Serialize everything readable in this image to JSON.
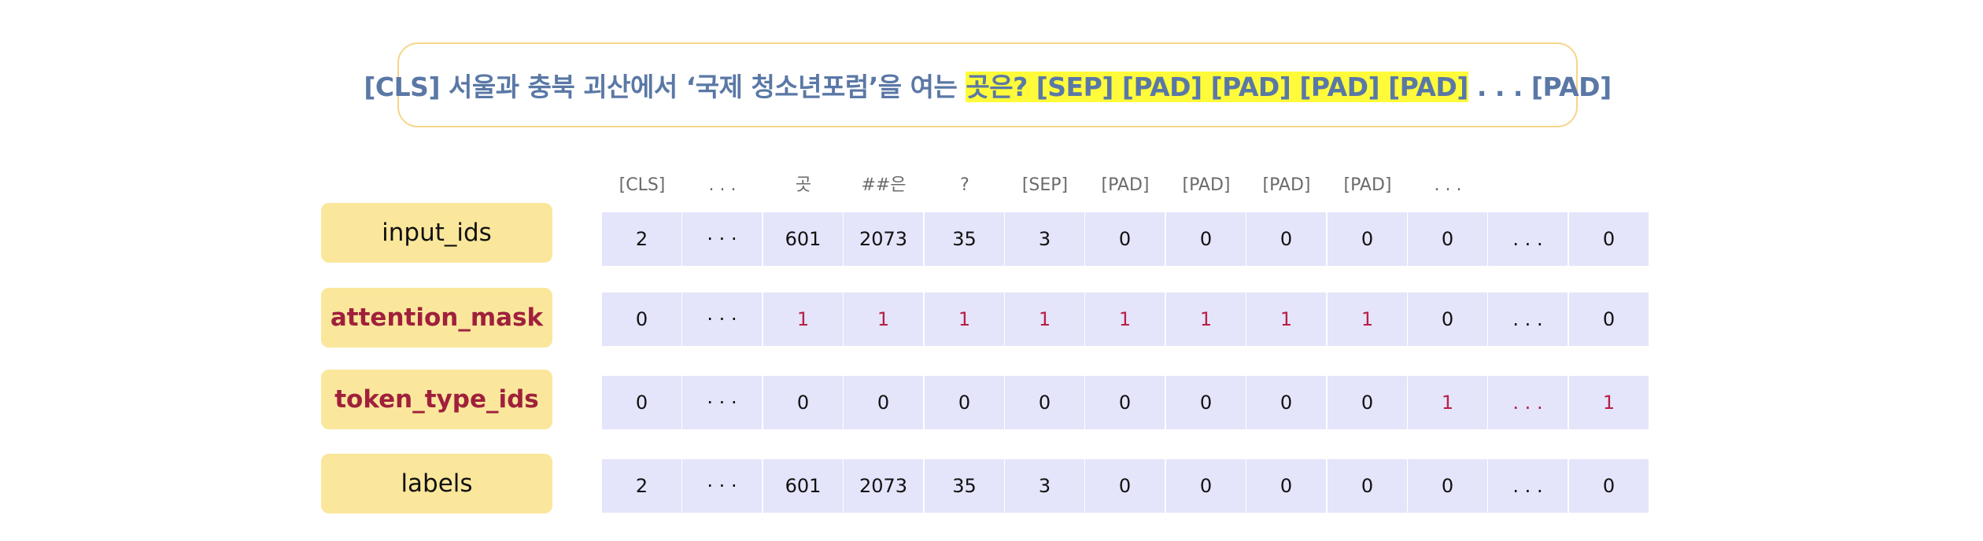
{
  "sentence": {
    "prefix": "[CLS] 서울과 충북 괴산에서 ‘국제 청소년포럼’을 여는 ",
    "highlight": "곳은? [SEP] [PAD] [PAD] [PAD] [PAD]",
    "suffix": " . . . [PAD]"
  },
  "tokens": [
    "[CLS]",
    ". . .",
    "곳",
    "##은",
    "?",
    "[SEP]",
    "[PAD]",
    "[PAD]",
    "[PAD]",
    "[PAD]",
    ". . .",
    "",
    ""
  ],
  "rows": [
    {
      "label": "input_ids",
      "emphasized": false,
      "cells": [
        "2",
        "· · ·",
        "601",
        "2073",
        "35",
        "3",
        "0",
        "0",
        "0",
        "0",
        "0",
        ". . .",
        "0"
      ],
      "highlight": [
        false,
        false,
        false,
        false,
        false,
        false,
        false,
        false,
        false,
        false,
        false,
        false,
        false
      ]
    },
    {
      "label": "attention_mask",
      "emphasized": true,
      "cells": [
        "0",
        "· · ·",
        "1",
        "1",
        "1",
        "1",
        "1",
        "1",
        "1",
        "1",
        "0",
        ". . .",
        "0"
      ],
      "highlight": [
        false,
        false,
        true,
        true,
        true,
        true,
        true,
        true,
        true,
        true,
        false,
        false,
        false
      ]
    },
    {
      "label": "token_type_ids",
      "emphasized": true,
      "cells": [
        "0",
        "· · ·",
        "0",
        "0",
        "0",
        "0",
        "0",
        "0",
        "0",
        "0",
        "1",
        ". . .",
        "1"
      ],
      "highlight": [
        false,
        false,
        false,
        false,
        false,
        false,
        false,
        false,
        false,
        false,
        true,
        true,
        true
      ]
    },
    {
      "label": "labels",
      "emphasized": false,
      "cells": [
        "2",
        "· · ·",
        "601",
        "2073",
        "35",
        "3",
        "0",
        "0",
        "0",
        "0",
        "0",
        ". . .",
        "0"
      ],
      "highlight": [
        false,
        false,
        false,
        false,
        false,
        false,
        false,
        false,
        false,
        false,
        false,
        false,
        false
      ]
    }
  ],
  "colors": {
    "sentence_text": "#5a78a6",
    "sentence_highlight": "#fffb3a",
    "label_fill": "#fae79c",
    "cell_fill": "#e4e4fb",
    "emphasis_red": "#b81f45"
  }
}
